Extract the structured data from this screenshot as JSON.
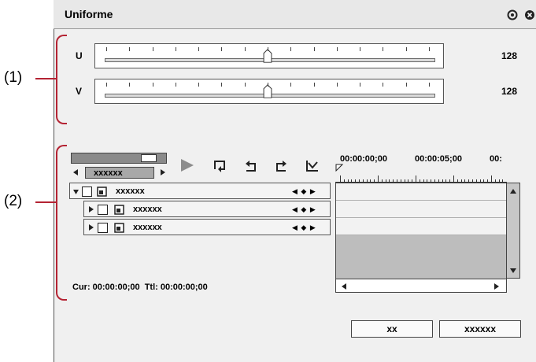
{
  "window": {
    "title": "Uniforme",
    "icons": [
      "circle-dot-icon",
      "close-icon"
    ]
  },
  "callouts": {
    "one": "(1)",
    "two": "(2)"
  },
  "sliders": [
    {
      "label": "U",
      "value_text": "128",
      "value": 128,
      "max": 255
    },
    {
      "label": "V",
      "value_text": "128",
      "value": 128,
      "max": 255
    }
  ],
  "keyframe": {
    "preset_label": "xxxxxx",
    "controls": [
      "play-icon",
      "loop-icon",
      "undo-icon",
      "redo-icon",
      "curve-icon"
    ],
    "timecodes": [
      "00:00:00;00",
      "00:00:05;00",
      "00:"
    ],
    "tracks": [
      {
        "label": "xxxxxx",
        "level": 0
      },
      {
        "label": "xxxxxx",
        "level": 1
      },
      {
        "label": "xxxxxx",
        "level": 1
      }
    ],
    "status": "Cur: 00:00:00;00  Ttl: 00:00:00;00"
  },
  "buttons": {
    "ok_label": "xx",
    "cancel_label": "xxxxxx"
  },
  "colors": {
    "callout_bracket": "#b42333",
    "window_bg": "#f0f0f0"
  }
}
